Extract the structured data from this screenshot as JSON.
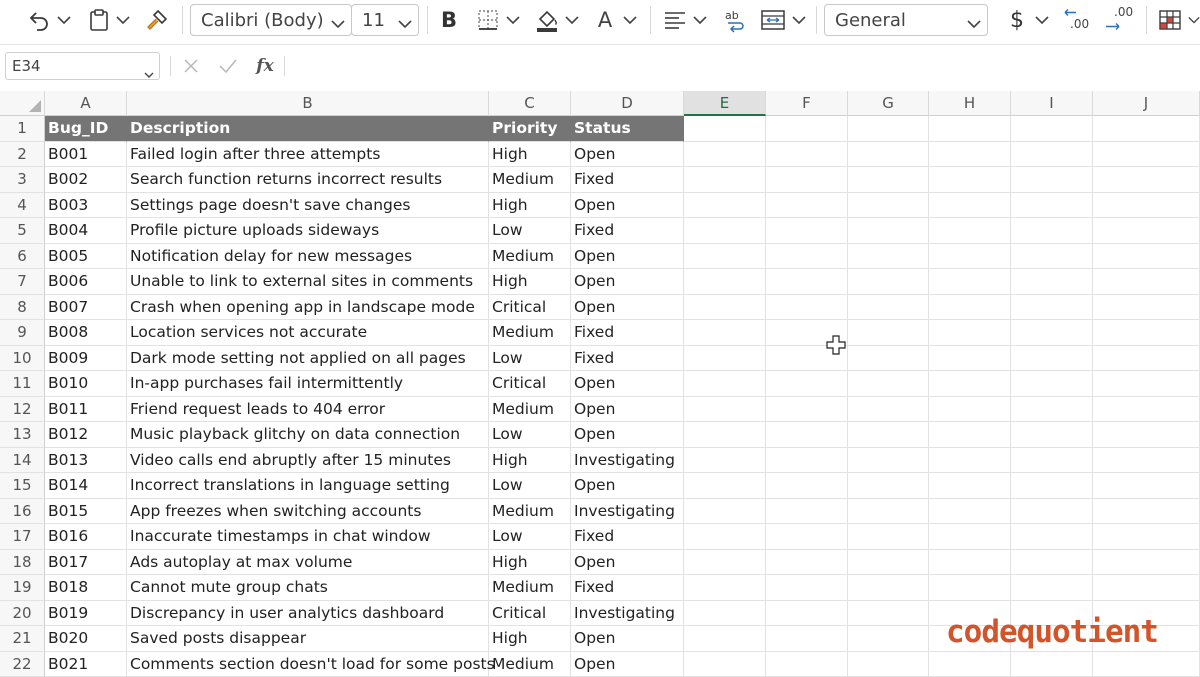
{
  "ribbon": {
    "font_name": "Calibri (Body)",
    "font_size": "11",
    "bold_label": "B",
    "font_color_label": "A",
    "number_format": "General",
    "currency_label": "$",
    "increase_decimal": ".00",
    "decrease_decimal": ".00"
  },
  "formula_bar": {
    "name_box": "E34",
    "fx_label": "fx",
    "formula": ""
  },
  "sheet": {
    "columns": [
      "A",
      "B",
      "C",
      "D",
      "E",
      "F",
      "G",
      "H",
      "I",
      "J"
    ],
    "selected_column": "E",
    "row_numbers": [
      "1",
      "2",
      "3",
      "4",
      "5",
      "6",
      "7",
      "8",
      "9",
      "10",
      "11",
      "12",
      "13",
      "14",
      "15",
      "16",
      "17",
      "18",
      "19",
      "20",
      "21",
      "22"
    ],
    "header": [
      "Bug_ID",
      "Description",
      "Priority",
      "Status"
    ],
    "rows": [
      [
        "B001",
        "Failed login after three attempts",
        "High",
        "Open"
      ],
      [
        "B002",
        "Search function returns incorrect results",
        "Medium",
        "Fixed"
      ],
      [
        "B003",
        "Settings page doesn't save changes",
        "High",
        "Open"
      ],
      [
        "B004",
        "Profile picture uploads sideways",
        "Low",
        "Fixed"
      ],
      [
        "B005",
        "Notification delay for new messages",
        "Medium",
        "Open"
      ],
      [
        "B006",
        "Unable to link to external sites in comments",
        "High",
        "Open"
      ],
      [
        "B007",
        "Crash when opening app in landscape mode",
        "Critical",
        "Open"
      ],
      [
        "B008",
        "Location services not accurate",
        "Medium",
        "Fixed"
      ],
      [
        "B009",
        "Dark mode setting not applied on all pages",
        "Low",
        "Fixed"
      ],
      [
        "B010",
        "In-app purchases fail intermittently",
        "Critical",
        "Open"
      ],
      [
        "B011",
        "Friend request leads to 404 error",
        "Medium",
        "Open"
      ],
      [
        "B012",
        "Music playback glitchy on data connection",
        "Low",
        "Open"
      ],
      [
        "B013",
        "Video calls end abruptly after 15 minutes",
        "High",
        "Investigating"
      ],
      [
        "B014",
        "Incorrect translations in language setting",
        "Low",
        "Open"
      ],
      [
        "B015",
        "App freezes when switching accounts",
        "Medium",
        "Investigating"
      ],
      [
        "B016",
        "Inaccurate timestamps in chat window",
        "Low",
        "Fixed"
      ],
      [
        "B017",
        "Ads autoplay at max volume",
        "High",
        "Open"
      ],
      [
        "B018",
        "Cannot mute group chats",
        "Medium",
        "Fixed"
      ],
      [
        "B019",
        "Discrepancy in user analytics dashboard",
        "Critical",
        "Investigating"
      ],
      [
        "B020",
        "Saved posts disappear",
        "High",
        "Open"
      ],
      [
        "B021",
        "Comments section doesn't load for some posts",
        "Medium",
        "Open"
      ]
    ]
  },
  "watermark": "codequotient",
  "colors": {
    "header_fill": "#757575",
    "selected_accent": "#217346",
    "watermark": "#d2542a"
  }
}
